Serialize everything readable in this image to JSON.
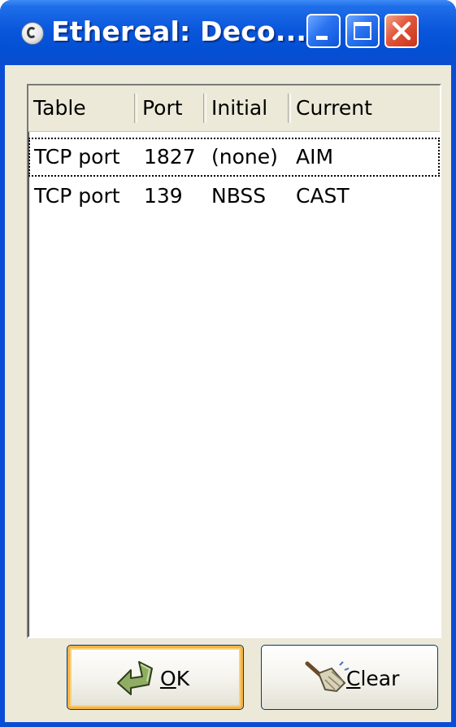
{
  "window": {
    "title": "Ethereal: Deco..."
  },
  "titlebar_buttons": {
    "minimize": "minimize",
    "maximize": "maximize",
    "close": "close"
  },
  "table": {
    "columns": [
      "Table",
      "Port",
      "Initial",
      "Current"
    ],
    "rows": [
      {
        "table": "TCP port",
        "port": "1827",
        "initial": "(none)",
        "current": "AIM"
      },
      {
        "table": "TCP port",
        "port": "139",
        "initial": "NBSS",
        "current": "CAST"
      }
    ],
    "selected_row": 0
  },
  "buttons": {
    "ok": {
      "mnemonic": "O",
      "rest": "K",
      "icon": "ok-arrow-icon"
    },
    "clear": {
      "mnemonic": "C",
      "rest": "lear",
      "icon": "broom-icon"
    }
  },
  "colors": {
    "titlebar": "#0350d4",
    "frame": "#0a4cd6",
    "face": "#ece9d8",
    "close": "#e2563a"
  }
}
